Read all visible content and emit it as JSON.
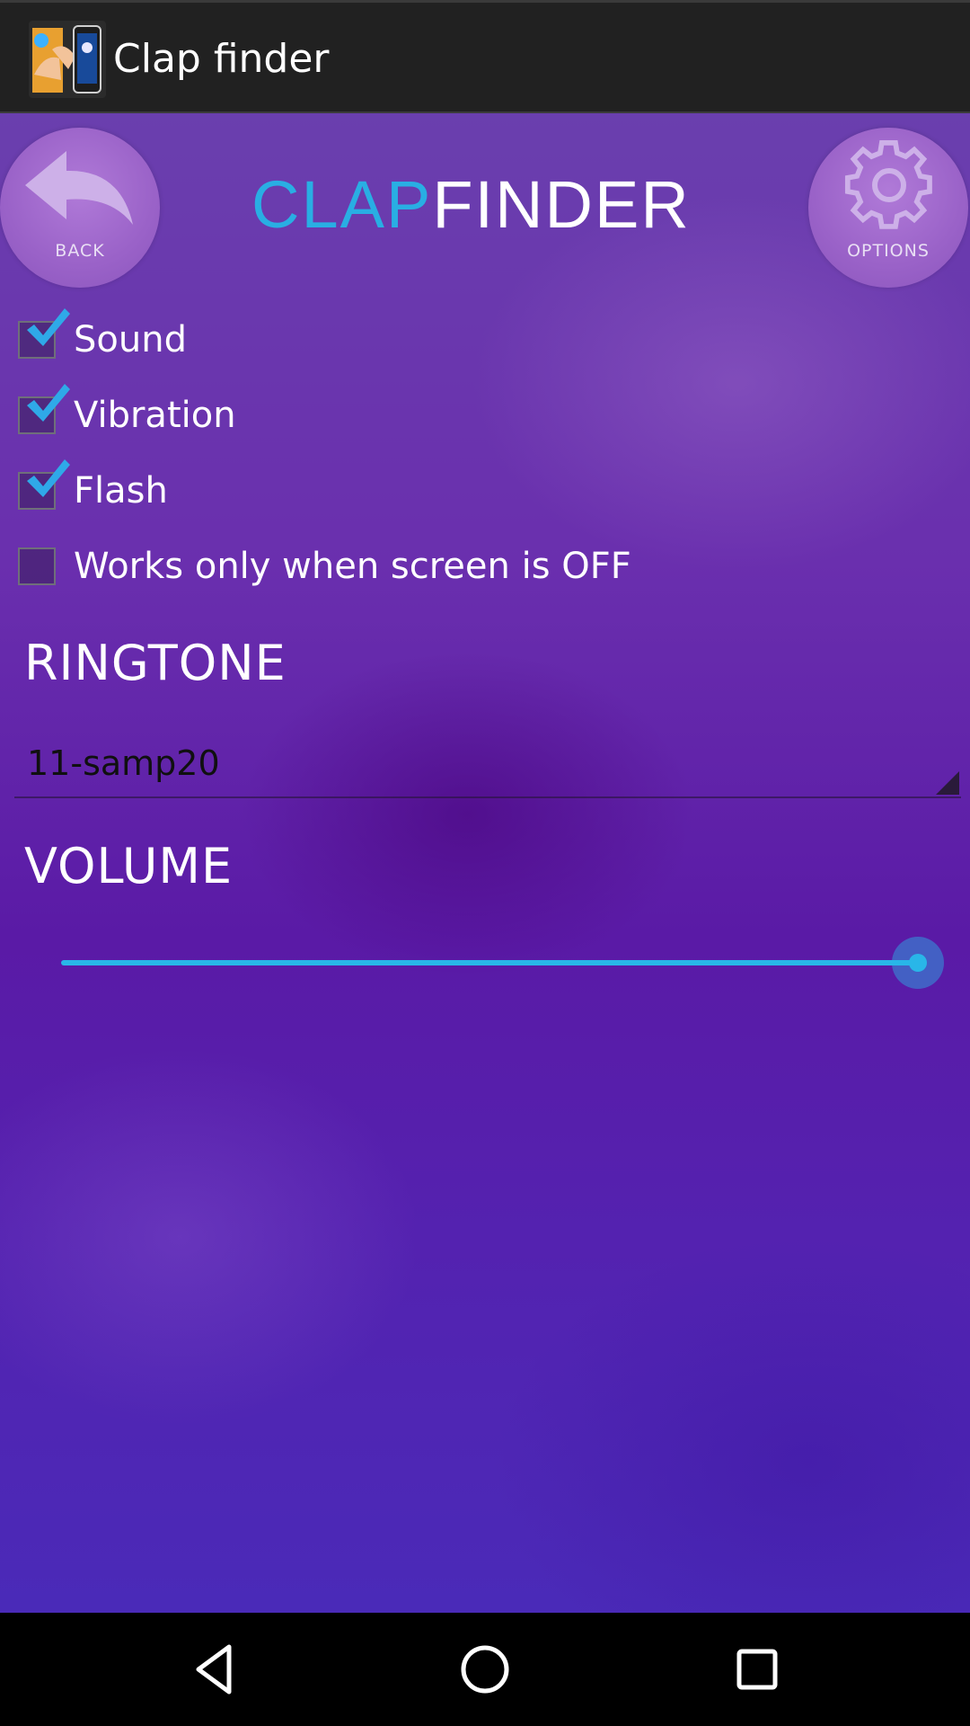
{
  "titlebar": {
    "title": "Clap finder",
    "icon": "app-hands-icon"
  },
  "header": {
    "back_label": "BACK",
    "back_icon": "undo-arrow-icon",
    "options_label": "OPTIONS",
    "options_icon": "gear-icon",
    "logo_part1": "CLAP",
    "logo_part2": "FINDER",
    "logo_colors": {
      "part1": "#29aee3",
      "part2": "#ffffff"
    }
  },
  "options": [
    {
      "label": "Sound",
      "checked": true
    },
    {
      "label": "Vibration",
      "checked": true
    },
    {
      "label": "Flash",
      "checked": true
    },
    {
      "label": "Works only when screen is OFF",
      "checked": false
    }
  ],
  "ringtone": {
    "heading": "RINGTONE",
    "value": "11-samp20"
  },
  "volume": {
    "heading": "VOLUME",
    "level": 1.0,
    "accent": "#29b6e8"
  },
  "navbar": {
    "back_icon": "triangle-back-icon",
    "home_icon": "circle-home-icon",
    "recents_icon": "square-recents-icon"
  }
}
